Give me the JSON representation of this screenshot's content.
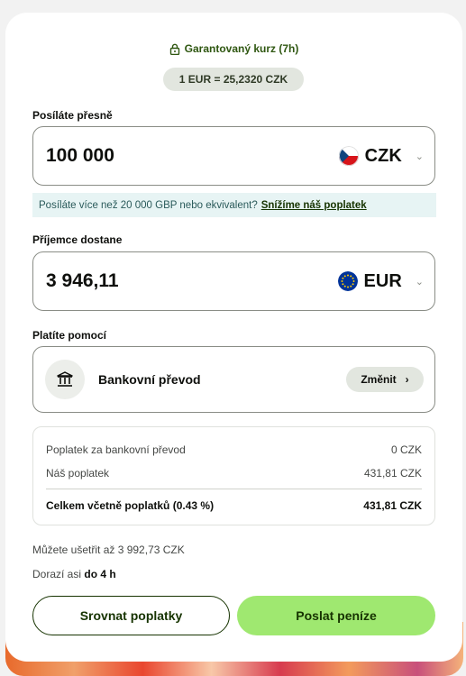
{
  "rate": {
    "guaranteed_label": "Garantovaný kurz (7h)",
    "value": "1 EUR = 25,2320 CZK"
  },
  "send": {
    "label": "Posíláte přesně",
    "amount": "100 000",
    "currency": "CZK",
    "flag": "czech-flag"
  },
  "notice": {
    "text": "Posíláte více než 20 000 GBP nebo ekvivalent?",
    "link": "Snížíme náš poplatek"
  },
  "receive": {
    "label": "Příjemce dostane",
    "amount": "3 946,11",
    "currency": "EUR",
    "flag": "eu-flag"
  },
  "payment": {
    "label": "Platíte pomocí",
    "method": "Bankovní převod",
    "change_label": "Změnit",
    "icon": "bank-icon"
  },
  "fees": {
    "rows": [
      {
        "label": "Poplatek za bankovní převod",
        "value": "0 CZK"
      },
      {
        "label": "Náš poplatek",
        "value": "431,81 CZK"
      }
    ],
    "total": {
      "label": "Celkem včetně poplatků (0.43 %)",
      "value": "431,81 CZK"
    }
  },
  "savings": "Můžete ušetřit až 3 992,73 CZK",
  "arrival": {
    "prefix": "Dorazí asi",
    "time": "do 4 h"
  },
  "buttons": {
    "compare": "Srovnat poplatky",
    "send": "Poslat peníze"
  },
  "colors": {
    "accent": "#9fe870",
    "dark_green": "#163300",
    "notice_bg": "#e7f4f4"
  }
}
